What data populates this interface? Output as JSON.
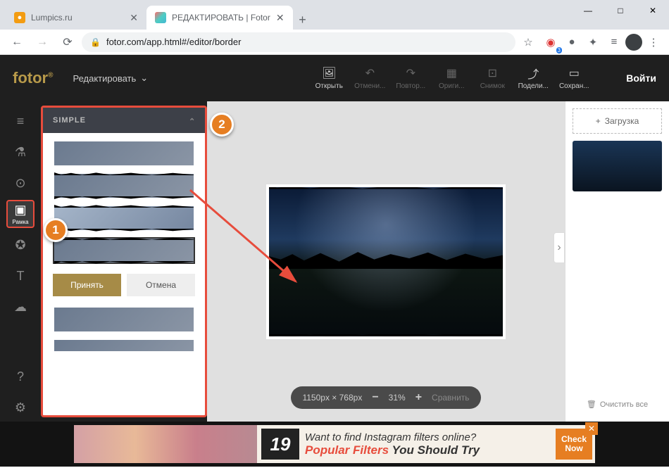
{
  "window": {
    "tabs": [
      {
        "title": "Lumpics.ru",
        "favicon_color": "#f39c12"
      },
      {
        "title": "РЕДАКТИРОВАТЬ | Fotor",
        "favicon_color": "linear"
      }
    ],
    "minimize": "—",
    "maximize": "□",
    "close": "✕"
  },
  "browser": {
    "url": "fotor.com/app.html#/editor/border",
    "star": "☆"
  },
  "app": {
    "logo": "fotor",
    "mode": "Редактировать",
    "toolbar": {
      "open": "Открыть",
      "undo": "Отмени...",
      "redo": "Повтор...",
      "original": "Ориги...",
      "snapshot": "Снимок",
      "share": "Подели...",
      "save": "Сохран..."
    },
    "login": "Войти"
  },
  "sidebar": {
    "frame_label": "Рамка"
  },
  "panel": {
    "header": "SIMPLE",
    "accept": "Принять",
    "cancel": "Отмена"
  },
  "zoombar": {
    "dimensions": "1150px × 768px",
    "level": "31%",
    "compare": "Сравнить"
  },
  "right": {
    "upload": "Загрузка",
    "clear": "Очистить все"
  },
  "ad": {
    "number": "19",
    "line1": "Want to find Instagram filters online?",
    "line2_a": "Popular Filters ",
    "line2_b": "You Should Try",
    "cta1": "Check",
    "cta2": "Now"
  },
  "annotations": {
    "one": "1",
    "two": "2"
  }
}
